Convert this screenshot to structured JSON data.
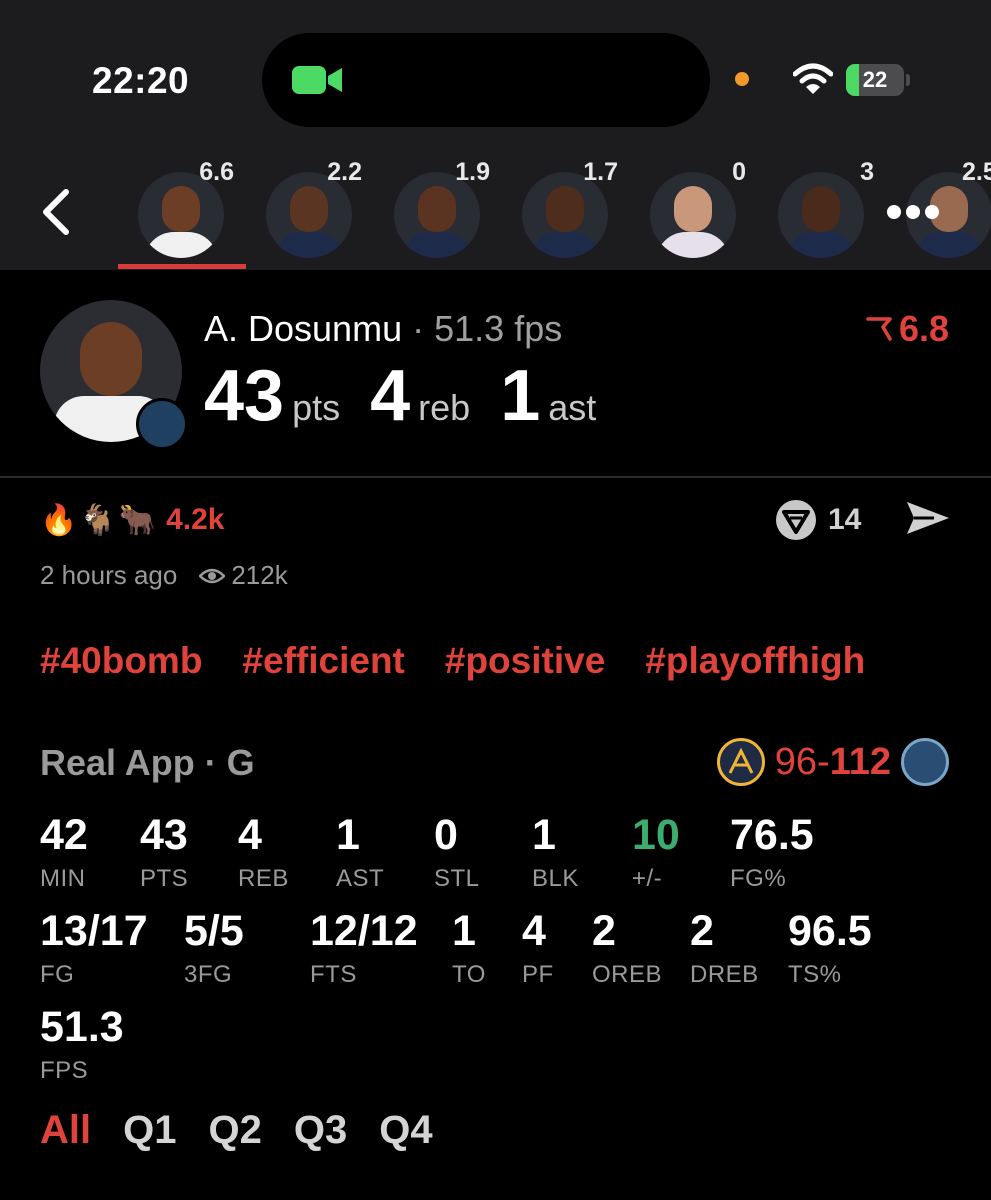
{
  "status_bar": {
    "time": "22:20",
    "battery": "22",
    "battery_level": 0.22
  },
  "player_strip": [
    {
      "score": "6.6",
      "selected": true
    },
    {
      "score": "2.2"
    },
    {
      "score": "1.9"
    },
    {
      "score": "1.7"
    },
    {
      "score": "0"
    },
    {
      "score": "3"
    },
    {
      "score": "2.5"
    }
  ],
  "player": {
    "name": "A. Dosunmu",
    "separator": "·",
    "fps": "51.3 fps",
    "rating": "6.8",
    "pts": "43",
    "pts_label": "pts",
    "reb": "4",
    "reb_label": "reb",
    "ast": "1",
    "ast_label": "ast"
  },
  "reactions": {
    "emojis": [
      "🔥",
      "🐐",
      "🐂"
    ],
    "count": "4.2k"
  },
  "comments": {
    "count": "14"
  },
  "meta": {
    "time_ago": "2 hours ago",
    "views": "212k"
  },
  "tags": [
    "#40bomb",
    "#efficient",
    "#positive",
    "#playoffhigh"
  ],
  "game": {
    "source": "Real App · G",
    "score_left": "96-",
    "score_right": "112",
    "colors": {
      "accent": "#e0423c",
      "positive": "#3cad6e"
    }
  },
  "stats": [
    {
      "value": "42",
      "label": "MIN"
    },
    {
      "value": "43",
      "label": "PTS"
    },
    {
      "value": "4",
      "label": "REB"
    },
    {
      "value": "1",
      "label": "AST"
    },
    {
      "value": "0",
      "label": "STL"
    },
    {
      "value": "1",
      "label": "BLK"
    },
    {
      "value": "10",
      "label": "+/-"
    },
    {
      "value": "76.5",
      "label": "FG%"
    },
    {
      "value": "13/17",
      "label": "FG"
    },
    {
      "value": "5/5",
      "label": "3FG"
    },
    {
      "value": "12/12",
      "label": "FTS"
    },
    {
      "value": "1",
      "label": "TO"
    },
    {
      "value": "4",
      "label": "PF"
    },
    {
      "value": "2",
      "label": "OREB"
    },
    {
      "value": "2",
      "label": "DREB"
    },
    {
      "value": "96.5",
      "label": "TS%"
    },
    {
      "value": "51.3",
      "label": "FPS"
    }
  ],
  "quarter_tabs": [
    "All",
    "Q1",
    "Q2",
    "Q3",
    "Q4"
  ]
}
